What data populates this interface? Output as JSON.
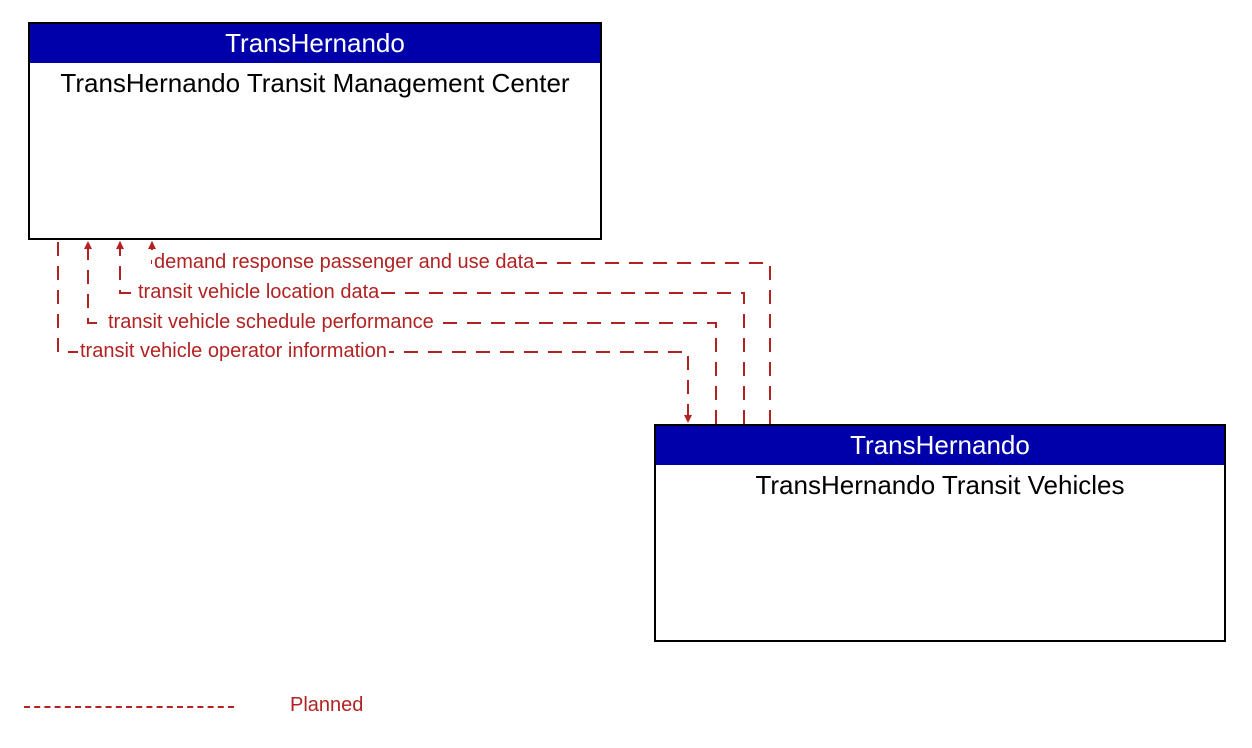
{
  "colors": {
    "header_bg": "#0000aa",
    "planned": "#b22222"
  },
  "entities": {
    "top": {
      "header": "TransHernando",
      "label": "TransHernando Transit Management Center"
    },
    "bottom": {
      "header": "TransHernando",
      "label": "TransHernando Transit Vehicles"
    }
  },
  "flows": {
    "f1": "demand response passenger and use data",
    "f2": "transit vehicle location data",
    "f3": "transit vehicle schedule performance",
    "f4": "transit vehicle operator information"
  },
  "legend": {
    "planned": "Planned"
  }
}
